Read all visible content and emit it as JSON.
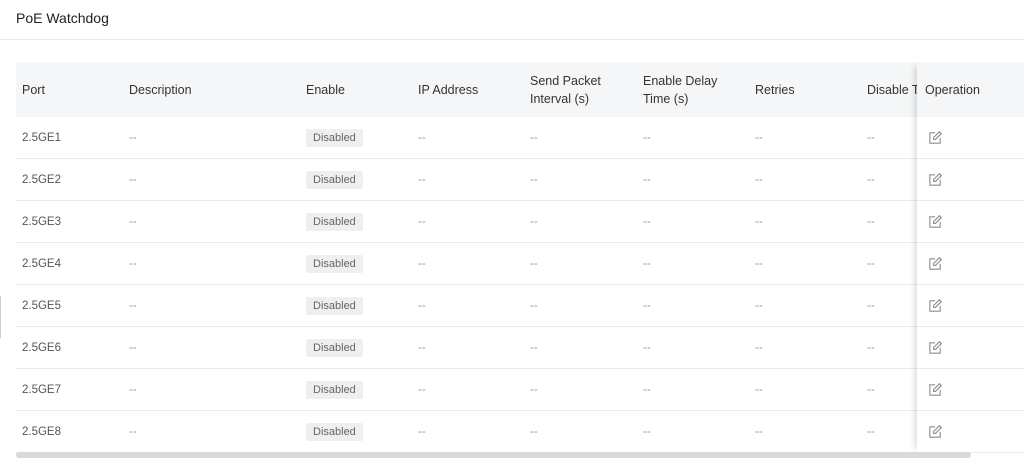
{
  "page": {
    "title": "PoE Watchdog"
  },
  "table": {
    "headers": {
      "port": "Port",
      "description": "Description",
      "enable": "Enable",
      "ip_address": "IP Address",
      "send_packet_interval": "Send Packet\nInterval (s)",
      "enable_delay_time": "Enable Delay\nTime (s)",
      "retries": "Retries",
      "disable_time": "Disable T",
      "operation": "Operation"
    },
    "rows": [
      {
        "port": "2.5GE1",
        "description": "--",
        "enable": "Disabled",
        "ip_address": "--",
        "send_packet_interval": "--",
        "enable_delay_time": "--",
        "retries": "--",
        "disable_time": "--"
      },
      {
        "port": "2.5GE2",
        "description": "--",
        "enable": "Disabled",
        "ip_address": "--",
        "send_packet_interval": "--",
        "enable_delay_time": "--",
        "retries": "--",
        "disable_time": "--"
      },
      {
        "port": "2.5GE3",
        "description": "--",
        "enable": "Disabled",
        "ip_address": "--",
        "send_packet_interval": "--",
        "enable_delay_time": "--",
        "retries": "--",
        "disable_time": "--"
      },
      {
        "port": "2.5GE4",
        "description": "--",
        "enable": "Disabled",
        "ip_address": "--",
        "send_packet_interval": "--",
        "enable_delay_time": "--",
        "retries": "--",
        "disable_time": "--"
      },
      {
        "port": "2.5GE5",
        "description": "--",
        "enable": "Disabled",
        "ip_address": "--",
        "send_packet_interval": "--",
        "enable_delay_time": "--",
        "retries": "--",
        "disable_time": "--"
      },
      {
        "port": "2.5GE6",
        "description": "--",
        "enable": "Disabled",
        "ip_address": "--",
        "send_packet_interval": "--",
        "enable_delay_time": "--",
        "retries": "--",
        "disable_time": "--"
      },
      {
        "port": "2.5GE7",
        "description": "--",
        "enable": "Disabled",
        "ip_address": "--",
        "send_packet_interval": "--",
        "enable_delay_time": "--",
        "retries": "--",
        "disable_time": "--"
      },
      {
        "port": "2.5GE8",
        "description": "--",
        "enable": "Disabled",
        "ip_address": "--",
        "send_packet_interval": "--",
        "enable_delay_time": "--",
        "retries": "--",
        "disable_time": "--"
      }
    ],
    "operation_icon": "edit-icon"
  },
  "colors": {
    "header_bg": "#f5f6f7",
    "row_border": "#ebebeb",
    "badge_bg": "#eeeff1",
    "icon_stroke": "#8a8f96"
  }
}
